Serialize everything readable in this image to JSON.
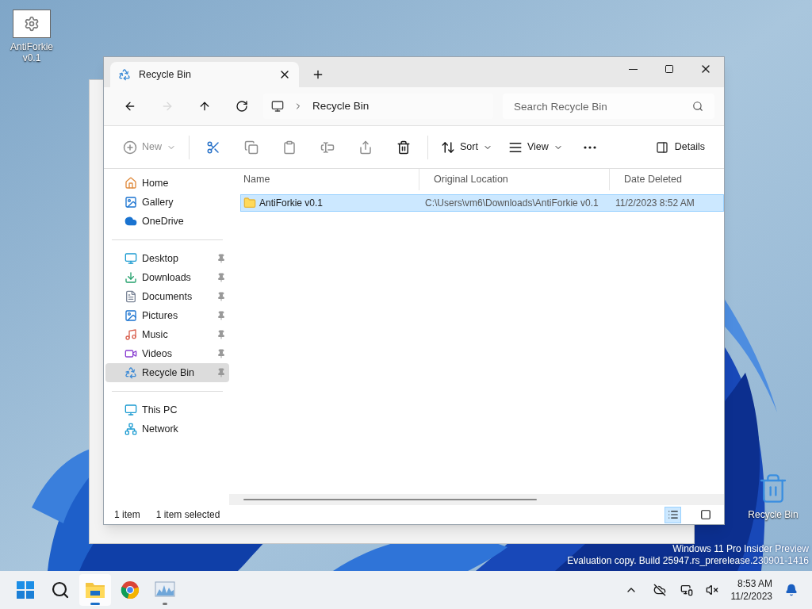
{
  "desktop_icons": [
    {
      "kind": "app",
      "label": "AntiForkie v0.1"
    },
    {
      "kind": "bin",
      "label": "Recycle Bin"
    }
  ],
  "window": {
    "tabs": [
      {
        "label": "Recycle Bin",
        "selected": true
      }
    ],
    "nav": [
      {
        "kind": "back",
        "disabled": false
      },
      {
        "kind": "forward",
        "disabled": true
      },
      {
        "kind": "up",
        "disabled": false
      },
      {
        "kind": "refresh",
        "disabled": false
      }
    ],
    "address": {
      "crumbs": [
        "Recycle Bin"
      ]
    },
    "search": {
      "placeholder": "Search Recycle Bin"
    },
    "toolbar": [
      {
        "kind": "new",
        "label": "New",
        "disabled": true
      },
      {
        "kind": "cut",
        "disabled": false
      },
      {
        "kind": "copy",
        "disabled": true
      },
      {
        "kind": "paste",
        "disabled": true
      },
      {
        "kind": "rename",
        "disabled": true
      },
      {
        "kind": "share",
        "disabled": true
      },
      {
        "kind": "delete",
        "disabled": false
      },
      {
        "kind": "sort",
        "label": "Sort",
        "disabled": false
      },
      {
        "kind": "view",
        "label": "View",
        "disabled": false
      },
      {
        "kind": "more",
        "disabled": false
      }
    ],
    "details_button": "Details",
    "sidebar": [
      [
        {
          "kind": "home",
          "label": "Home",
          "pinned": false,
          "selected": false
        },
        {
          "kind": "gallery",
          "label": "Gallery",
          "pinned": false,
          "selected": false
        },
        {
          "kind": "onedrive",
          "label": "OneDrive",
          "pinned": false,
          "selected": false
        }
      ],
      [
        {
          "kind": "desktop",
          "label": "Desktop",
          "pinned": true,
          "selected": false
        },
        {
          "kind": "downloads",
          "label": "Downloads",
          "pinned": true,
          "selected": false
        },
        {
          "kind": "documents",
          "label": "Documents",
          "pinned": true,
          "selected": false
        },
        {
          "kind": "pictures",
          "label": "Pictures",
          "pinned": true,
          "selected": false
        },
        {
          "kind": "music",
          "label": "Music",
          "pinned": true,
          "selected": false
        },
        {
          "kind": "videos",
          "label": "Videos",
          "pinned": true,
          "selected": false
        },
        {
          "kind": "bin",
          "label": "Recycle Bin",
          "pinned": true,
          "selected": true
        }
      ],
      [
        {
          "kind": "pc",
          "label": "This PC",
          "pinned": false,
          "selected": false
        },
        {
          "kind": "network",
          "label": "Network",
          "pinned": false,
          "selected": false
        }
      ]
    ],
    "table": {
      "columns": [
        "Name",
        "Original Location",
        "Date Deleted"
      ],
      "rows": [
        {
          "name": "AntiForkie v0.1",
          "location": "C:\\Users\\vm6\\Downloads\\AntiForkie v0.1",
          "date": "11/2/2023 8:52 AM",
          "selected": true
        }
      ]
    },
    "status_bar": {
      "count": "1 item",
      "selection": "1 item selected"
    },
    "view_toggles": [
      {
        "kind": "details",
        "selected": true
      },
      {
        "kind": "tiles",
        "selected": false
      }
    ]
  },
  "watermark": [
    "Windows 11 Pro Insider Preview",
    "Evaluation copy. Build 25947.rs_prerelease.230901-1416"
  ],
  "taskbar": {
    "apps": [
      {
        "kind": "start",
        "active": false,
        "running": false
      },
      {
        "kind": "search",
        "active": false,
        "running": false
      },
      {
        "kind": "explorer",
        "active": true,
        "running": true
      },
      {
        "kind": "browser",
        "active": false,
        "running": false
      },
      {
        "kind": "monitor",
        "active": false,
        "running": true
      }
    ],
    "tray": {
      "time": "8:53 AM",
      "date": "11/2/2023"
    }
  }
}
